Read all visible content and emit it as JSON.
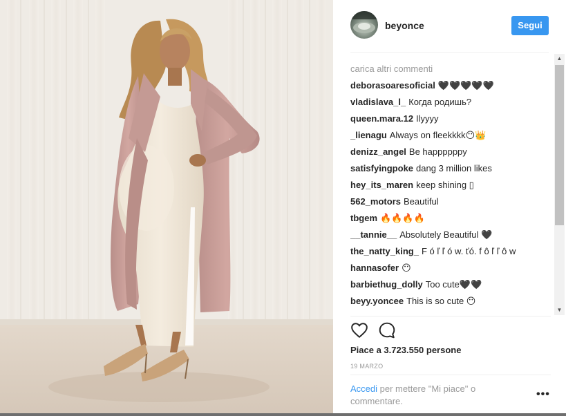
{
  "post": {
    "username": "beyonce",
    "follow_label": "Segui"
  },
  "comments": {
    "load_more": "carica altri commenti",
    "items": [
      {
        "user": "deborasoaresoficial",
        "text": "🖤🖤🖤🖤🖤"
      },
      {
        "user": "vladislava_l_",
        "text": "Когда родишь?"
      },
      {
        "user": "queen.mara.12",
        "text": "Ilyyyy"
      },
      {
        "user": "_lienagu",
        "text": "Always on fleekkkk😶👑"
      },
      {
        "user": "denizz_angel",
        "text": "Be happppppy"
      },
      {
        "user": "satisfyingpoke",
        "text": "dang 3 million likes"
      },
      {
        "user": "hey_its_maren",
        "text": "keep shining ▯"
      },
      {
        "user": "562_motors",
        "text": "Beautiful"
      },
      {
        "user": "tbgem",
        "text": "🔥🔥🔥🔥"
      },
      {
        "user": "__tannie__",
        "text": "Absolutely Beautiful 🖤"
      },
      {
        "user": "the_natty_king_",
        "text": "F ó ľ ľ ó w.  ťó. f ô ľ ľ ô w"
      },
      {
        "user": "hannasofer",
        "text": "😶"
      },
      {
        "user": "barbiethug_dolly",
        "text": "Too cute🖤🖤"
      },
      {
        "user": "beyy.yoncee",
        "text": "This is so cute 😶"
      }
    ]
  },
  "likes_text": "Piace a 3.723.550 persone",
  "date": "19 MARZO",
  "login": {
    "link": "Accedi",
    "text": " per mettere \"Mi piace\" o commentare."
  },
  "more_label": "•••",
  "icons": {
    "like": "heart-icon",
    "comment": "comment-icon"
  },
  "colors": {
    "accent": "#3897f0",
    "muted": "#999999"
  }
}
